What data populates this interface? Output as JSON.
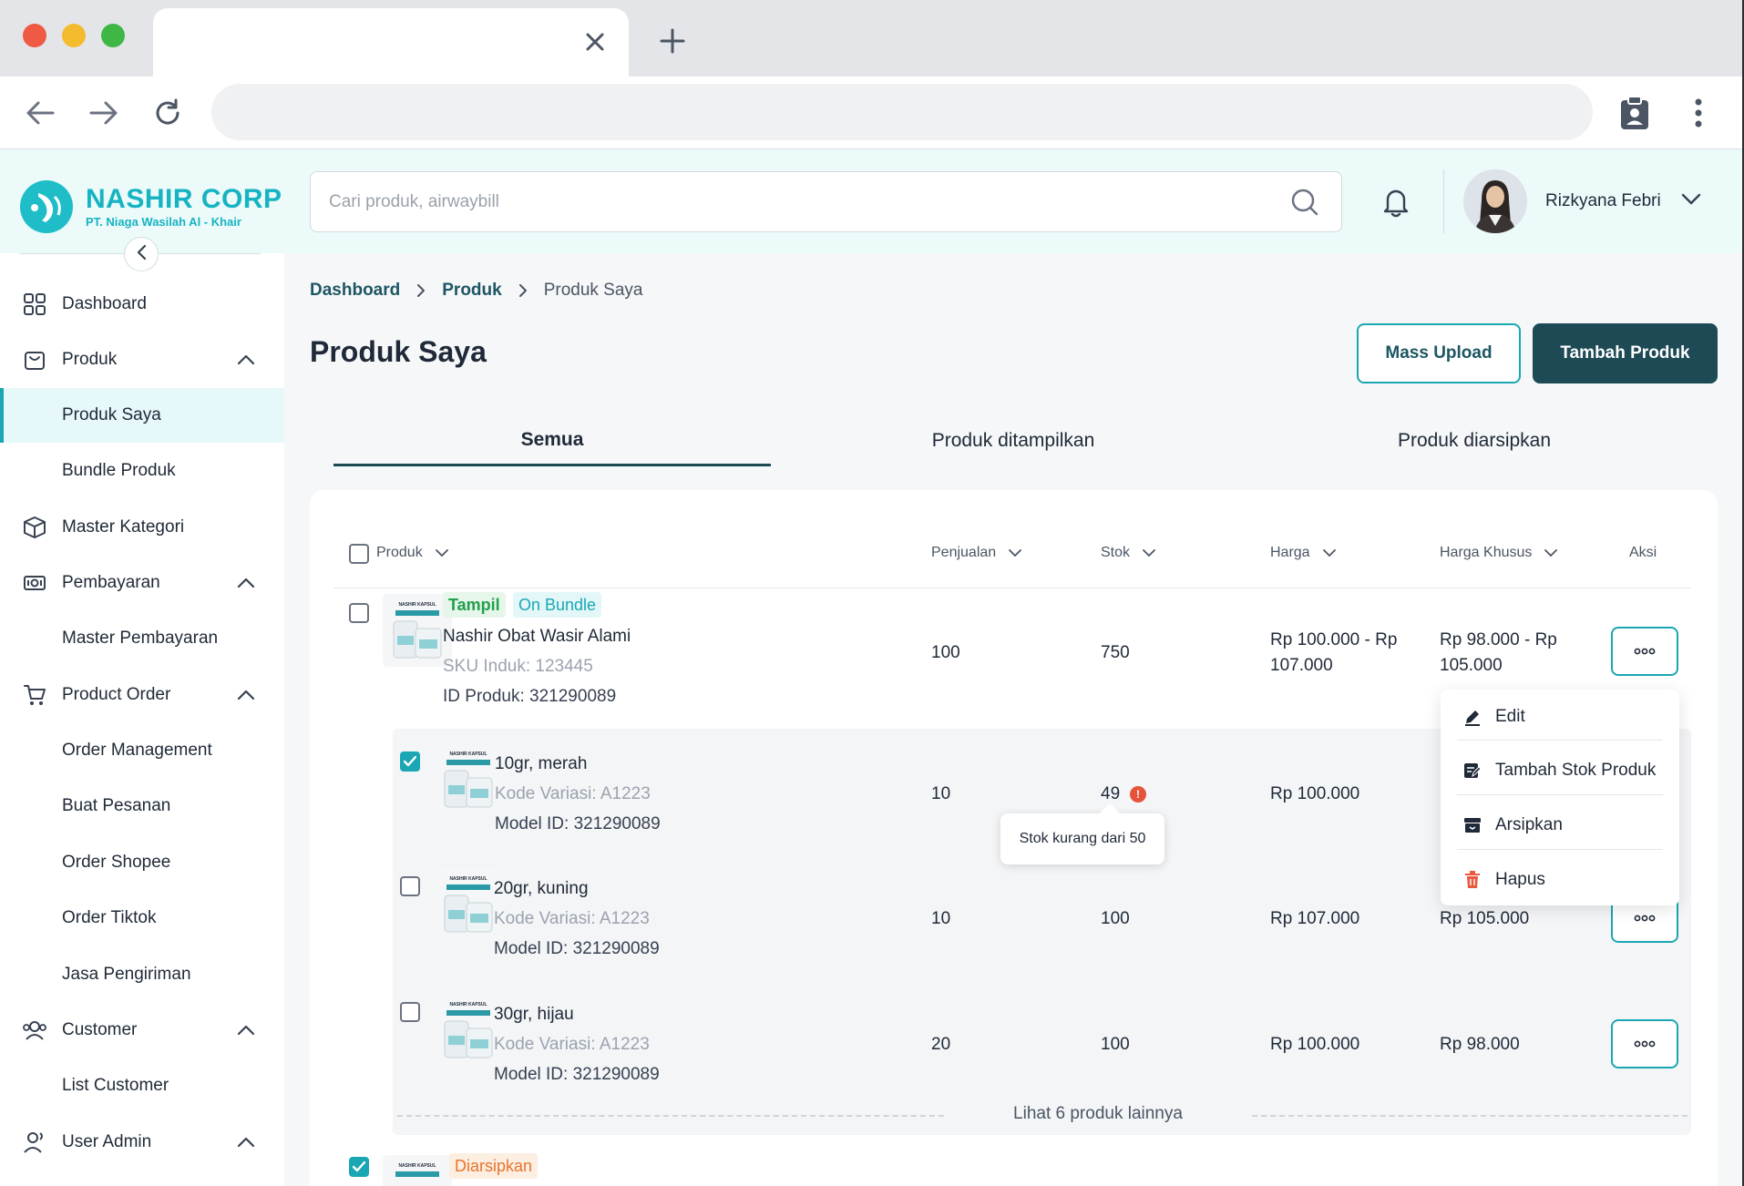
{
  "browser": {
    "new_tab_label": "+"
  },
  "header": {
    "brand_name": "NASHIR CORP",
    "brand_sub": "PT. Niaga Wasilah Al - Khair",
    "search_placeholder": "Cari produk, airwaybill",
    "user_name": "Rizkyana Febri"
  },
  "sidebar": {
    "items": [
      {
        "label": "Dashboard"
      },
      {
        "label": "Produk"
      },
      {
        "label": "Produk Saya"
      },
      {
        "label": "Bundle Produk"
      },
      {
        "label": "Master Kategori"
      },
      {
        "label": "Pembayaran"
      },
      {
        "label": "Master Pembayaran"
      },
      {
        "label": "Product Order"
      },
      {
        "label": "Order Management"
      },
      {
        "label": "Buat Pesanan"
      },
      {
        "label": "Order Shopee"
      },
      {
        "label": "Order Tiktok"
      },
      {
        "label": "Jasa Pengiriman"
      },
      {
        "label": "Customer"
      },
      {
        "label": "List Customer"
      },
      {
        "label": "User Admin"
      }
    ]
  },
  "breadcrumb": {
    "items": [
      "Dashboard",
      "Produk",
      "Produk Saya"
    ]
  },
  "page": {
    "title": "Produk Saya",
    "mass_upload_label": "Mass Upload",
    "add_product_label": "Tambah Produk"
  },
  "tabs": [
    "Semua",
    "Produk ditampilkan",
    "Produk diarsipkan"
  ],
  "table": {
    "headers": [
      "Produk",
      "Penjualan",
      "Stok",
      "Harga",
      "Harga Khusus",
      "Aksi"
    ],
    "product": {
      "badge_1": "Tampil",
      "badge_2": "On Bundle",
      "name": "Nashir Obat Wasir Alami",
      "sku": "SKU Induk: 123445",
      "id": "ID Produk: 321290089",
      "sales": "100",
      "stock": "750",
      "price_1": "Rp 100.000 - Rp",
      "price_2": "107.000",
      "special_1": "Rp 98.000 - Rp",
      "special_2": "105.000"
    },
    "variants": [
      {
        "name": "10gr, merah",
        "code": "Kode Variasi: A1223",
        "model": "Model ID: 321290089",
        "sales": "10",
        "stock": "49",
        "price": "Rp 100.000",
        "special": ""
      },
      {
        "name": "20gr, kuning",
        "code": "Kode Variasi: A1223",
        "model": "Model ID: 321290089",
        "sales": "10",
        "stock": "100",
        "price": "Rp 107.000",
        "special": "Rp 105.000"
      },
      {
        "name": "30gr, hijau",
        "code": "Kode Variasi: A1223",
        "model": "Model ID: 321290089",
        "sales": "20",
        "stock": "100",
        "price": "Rp 100.000",
        "special": "Rp 98.000"
      }
    ],
    "see_more": "Lihat 6 produk lainnya",
    "next_badge": "Diarsipkan",
    "thumb_label": "NASHIR KAPSUL"
  },
  "tooltip": {
    "text": "Stok kurang dari 50",
    "warn_glyph": "!"
  },
  "dropdown": {
    "items": [
      "Edit",
      "Tambah Stok Produk",
      "Arsipkan",
      "Hapus"
    ]
  },
  "colors": {
    "brand": "#16b3c2",
    "primary_dark": "#1d4a55",
    "accent": "#1aa7b3",
    "warning": "#e5533b"
  }
}
